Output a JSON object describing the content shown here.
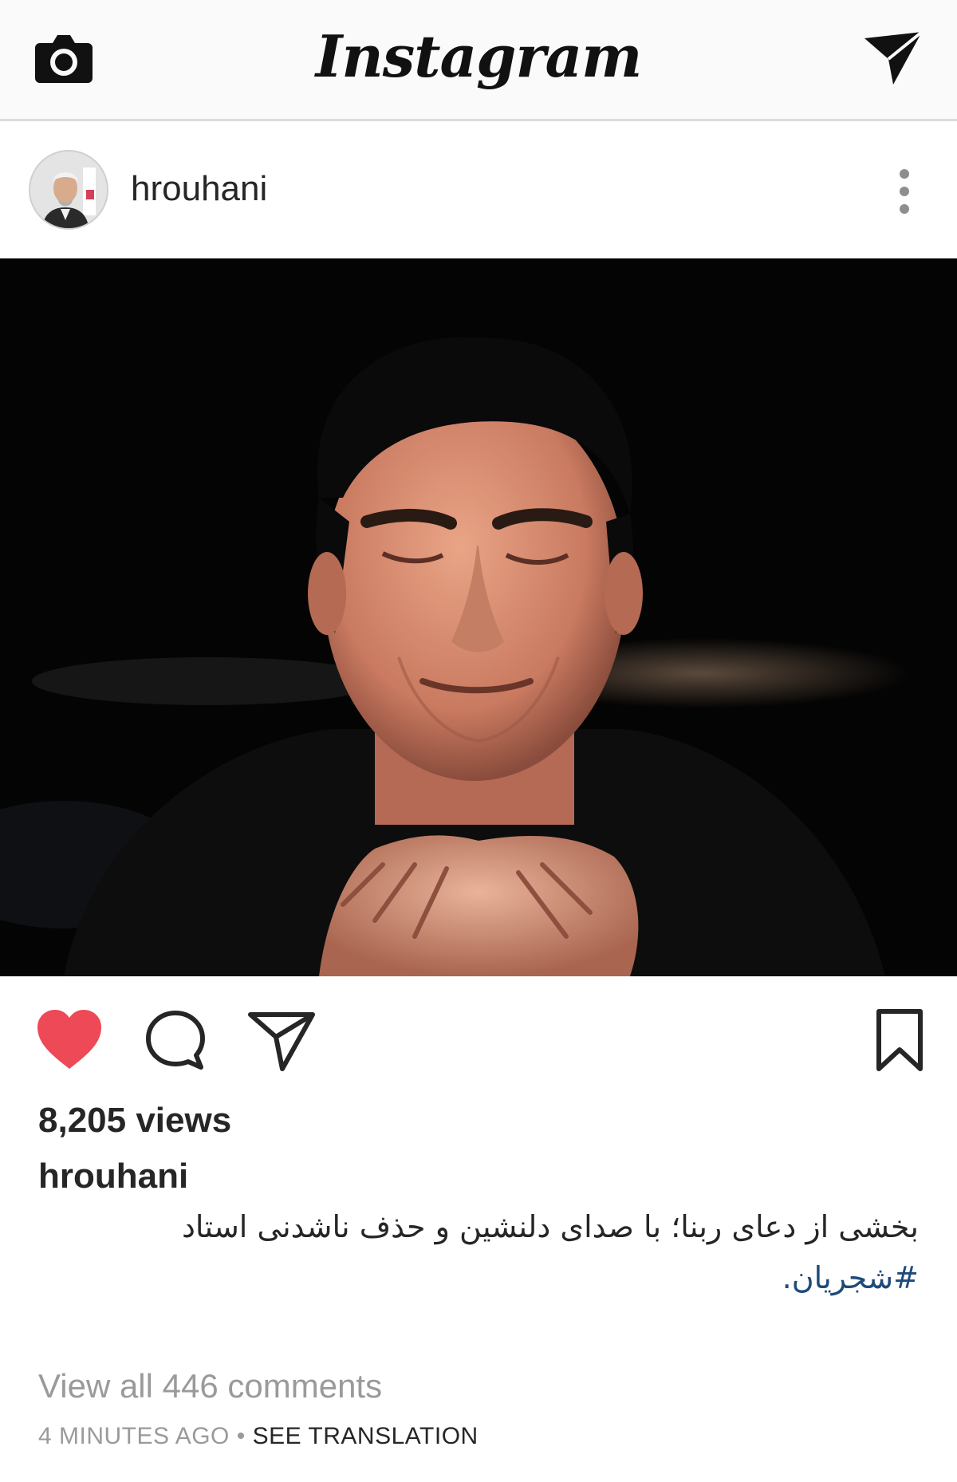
{
  "app": {
    "title": "Instagram"
  },
  "icons": {
    "camera": "camera-icon",
    "direct": "paper-plane-icon",
    "more": "vertical-dots-icon",
    "like": "heart-icon",
    "comment": "speech-bubble-icon",
    "share": "paper-plane-icon",
    "save": "bookmark-icon"
  },
  "colors": {
    "like_active": "#ed4956",
    "hashtag": "#1f4a7a",
    "muted_text": "#9a9a9a",
    "header_bg": "#fafafa"
  },
  "post": {
    "username": "hrouhani",
    "liked": true,
    "views": "8,205 views",
    "caption_user": "hrouhani",
    "caption_text": "بخشی از دعای ربنا؛ با صدای دلنشین و حذف ناشدنی استاد",
    "caption_hashtag": "#شجریان.",
    "view_all_comments": "View all 446 comments",
    "time_ago": "4 MINUTES AGO",
    "separator": "•",
    "see_translation": "SEE TRANSLATION"
  }
}
